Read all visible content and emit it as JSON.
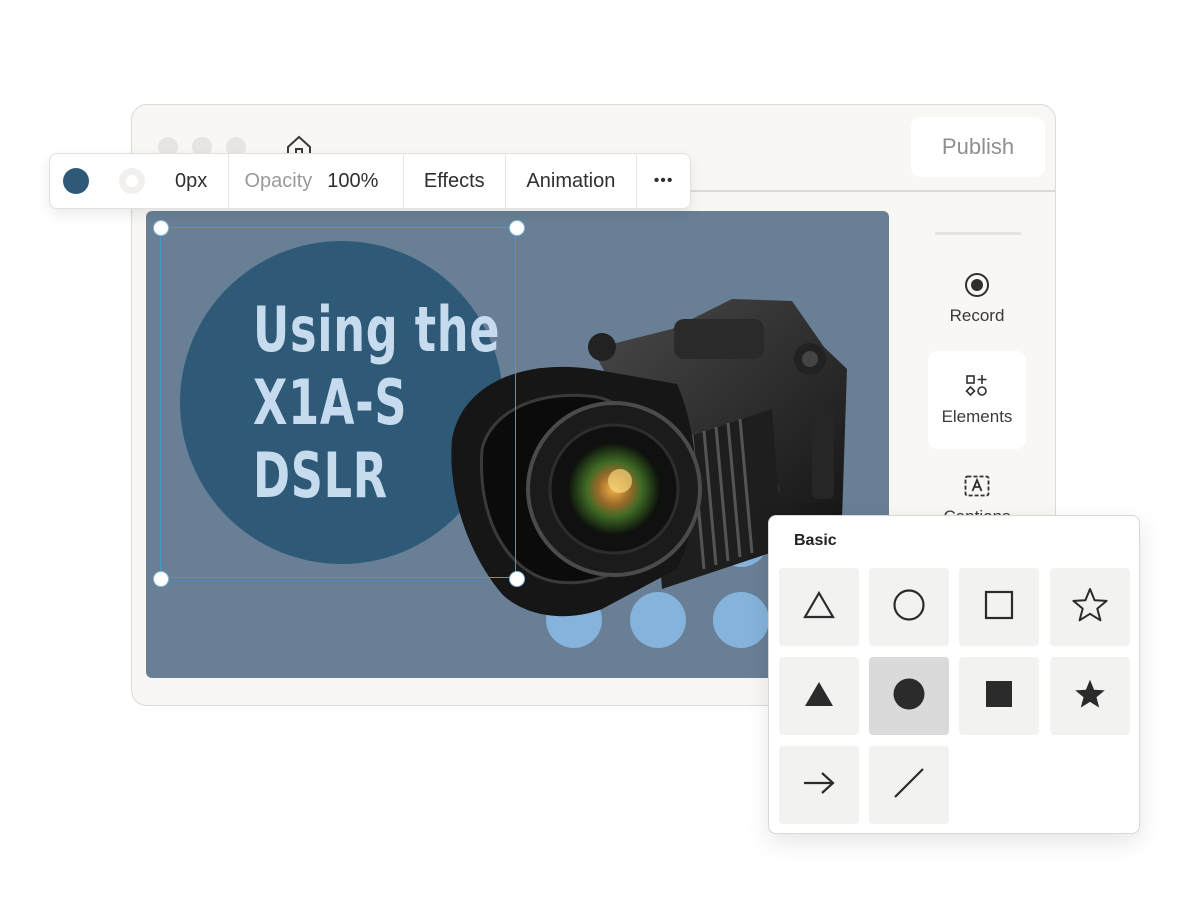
{
  "header": {
    "publish_label": "Publish"
  },
  "toolbar": {
    "stroke_width": "0px",
    "opacity_label": "Opacity",
    "opacity_value": "100%",
    "effects_label": "Effects",
    "animation_label": "Animation",
    "more_label": "•••",
    "fill_color": "#2e5a78"
  },
  "sidebar": {
    "items": [
      {
        "label": "Record",
        "icon": "record-icon"
      },
      {
        "label": "Elements",
        "icon": "elements-icon"
      },
      {
        "label": "Captions",
        "icon": "captions-icon"
      }
    ]
  },
  "slide": {
    "headline_lines": [
      "Using the",
      "X1A-S",
      "DSLR"
    ],
    "background_color": "#687f95",
    "circle_color": "#2e5a78",
    "dot_color": "#85b3dc"
  },
  "shapes_panel": {
    "title": "Basic",
    "shapes": [
      "triangle-outline-icon",
      "circle-outline-icon",
      "square-outline-icon",
      "star-outline-icon",
      "triangle-filled-icon",
      "circle-filled-icon",
      "square-filled-icon",
      "star-filled-icon",
      "arrow-icon",
      "line-icon"
    ]
  }
}
